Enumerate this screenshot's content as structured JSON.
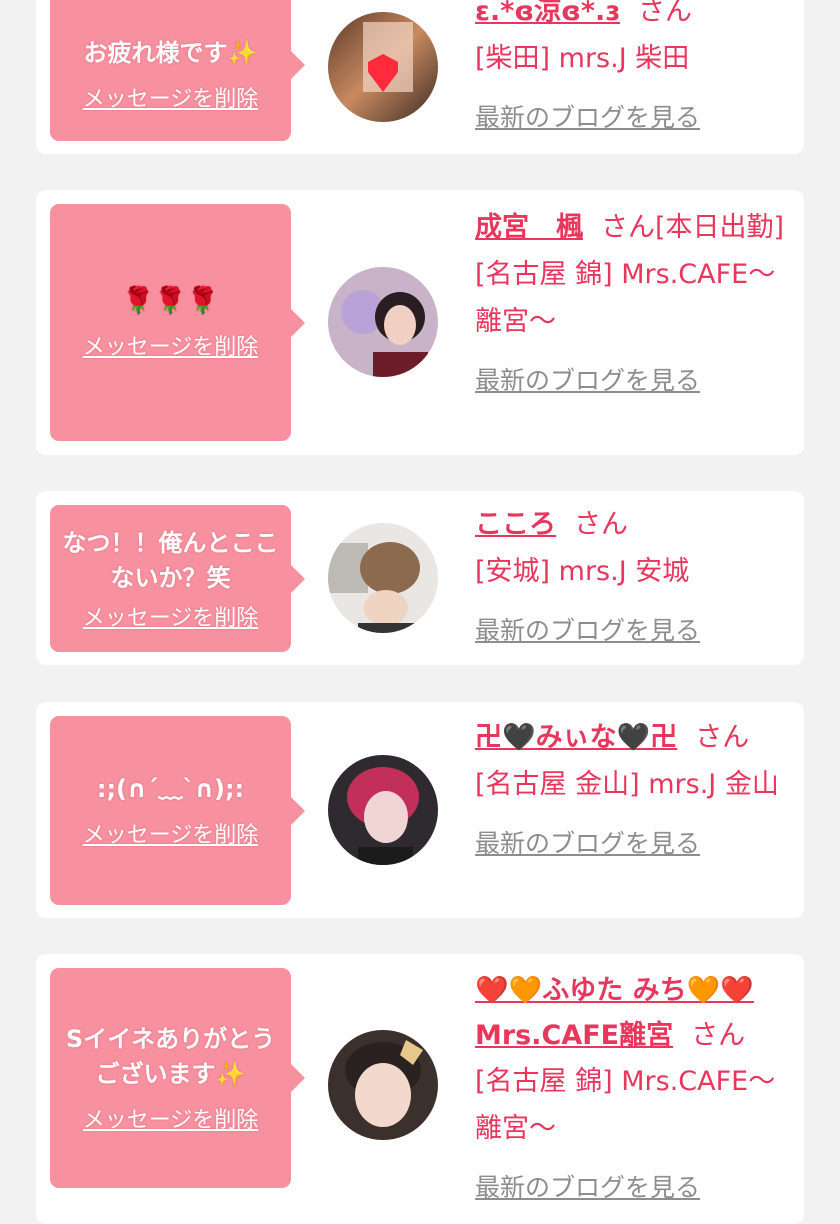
{
  "delete_label": "メッセージを削除",
  "blog_label": "最新のブログを見る",
  "san_label": "さん",
  "cards": [
    {
      "message": "お疲れ様です✨",
      "name": "ɛ.*ɞ涼ɞ*.ɜ",
      "suffix": "",
      "shop": "[柴田] mrs.J 柴田"
    },
    {
      "message": "🌹🌹🌹",
      "name": "成宮　楓",
      "suffix": "[本日出勤]",
      "shop": "[名古屋 錦] Mrs.CAFE～離宮～"
    },
    {
      "message": "なつ！！俺んとここないか？笑",
      "name": "こころ",
      "suffix": "",
      "shop": "[安城] mrs.J 安城"
    },
    {
      "message": ":;(∩´﹏`∩);:",
      "name": "卍🖤みぃな🖤卍",
      "suffix": "",
      "shop": "[名古屋 金山] mrs.J 金山"
    },
    {
      "message": "Sイイネありがとうございます✨",
      "name": "❤️🧡ふゆた みち🧡❤️Mrs.CAFE離宮",
      "suffix": "",
      "shop": "[名古屋 錦] Mrs.CAFE～離宮～"
    }
  ],
  "colors": {
    "accent": "#e8365d",
    "bubble": "#f7909f",
    "link_gray": "#8d8d8d",
    "background": "#f2f2f2"
  }
}
